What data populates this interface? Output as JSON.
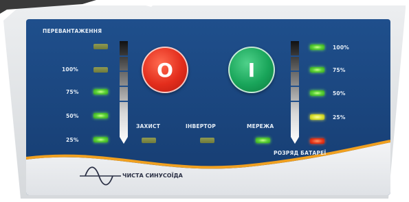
{
  "panel": {
    "overload_title": "ПЕРЕВАНТАЖЕННЯ",
    "left_levels": [
      "100%",
      "75%",
      "50%",
      "25%"
    ],
    "right_levels": [
      "100%",
      "75%",
      "50%",
      "25%"
    ],
    "status_labels": {
      "protection": "ЗАХИСТ",
      "inverter": "ІНВЕРТОР",
      "mains": "МЕРЕЖА"
    },
    "battery_discharge": "РОЗРЯД БАТАРЕЇ",
    "buttons": {
      "off": "O",
      "on": "I"
    },
    "footer_label": "ЧИСТА СИНУСОЇДА"
  },
  "colors": {
    "panel_blue": "#1b4a86",
    "off_button": "#e32d1c",
    "on_button": "#19a55a",
    "wave_orange": "#f0a020"
  },
  "icons": [
    "sine-wave-icon"
  ]
}
